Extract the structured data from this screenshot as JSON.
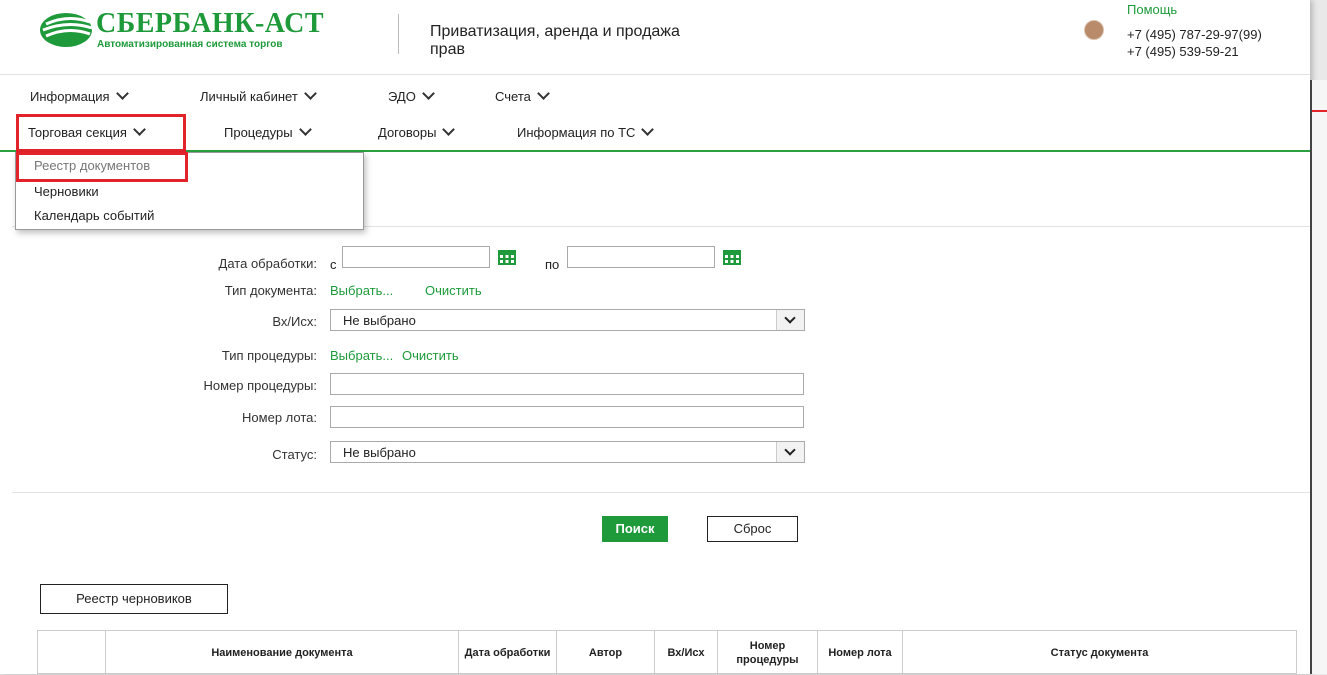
{
  "header": {
    "brand": "СБЕРБАНК-АСТ",
    "brand_sub": "Автоматизированная система торгов",
    "tagline": "Приватизация, аренда и продажа прав",
    "help": "Помощь",
    "phone1": "+7 (495) 787-29-97(99)",
    "phone2": "+7 (495) 539-59-21"
  },
  "menu_top": [
    "Информация",
    "Личный кабинет",
    "ЭДО",
    "Счета"
  ],
  "menu_second": [
    "Торговая секция",
    "Процедуры",
    "Договоры",
    "Информация по ТС"
  ],
  "dropdown": [
    "Реестр документов",
    "Черновики",
    "Календарь событий"
  ],
  "form": {
    "date_label": "Дата обработки:",
    "date_from": "с",
    "date_to": "по",
    "doc_type_label": "Тип документа:",
    "doc_type_select": "Выбрать...",
    "doc_type_clear": "Очистить",
    "inout_label": "Вх/Исх:",
    "inout_value": "Не выбрано",
    "proc_type_label": "Тип процедуры:",
    "proc_type_select": "Выбрать...",
    "proc_type_clear": "Очистить",
    "proc_number_label": "Номер процедуры:",
    "lot_number_label": "Номер лота:",
    "status_label": "Статус:",
    "status_value": "Не выбрано"
  },
  "buttons": {
    "search": "Поиск",
    "reset": "Сброс",
    "drafts_registry": "Реестр черновиков"
  },
  "table": {
    "columns": [
      "",
      "Наименование документа",
      "Дата обработки",
      "Автор",
      "Вх/Исх",
      "Номер процедуры",
      "Номер лота",
      "Статус документа"
    ]
  },
  "colors": {
    "brand_green": "#1e9a3a",
    "highlight_red": "#e2242a"
  }
}
